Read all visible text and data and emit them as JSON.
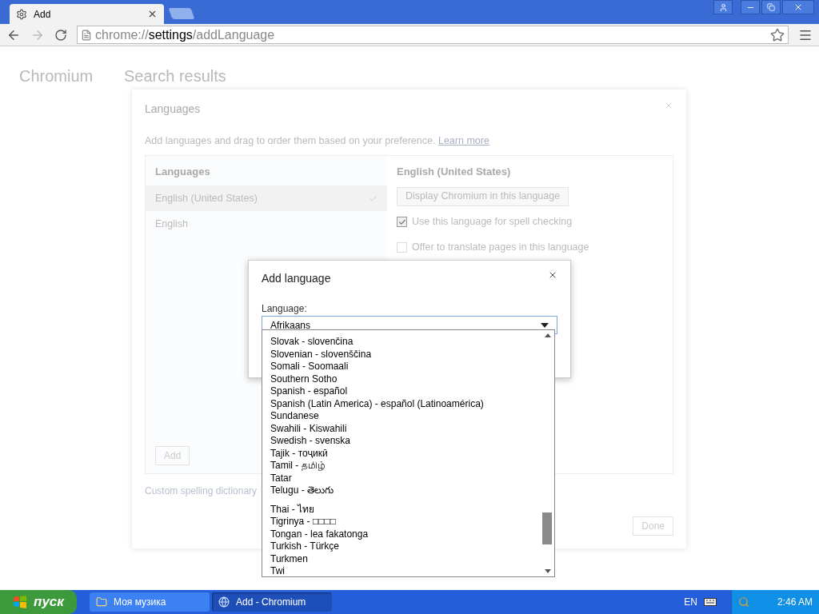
{
  "browser": {
    "tab": {
      "title": "Add"
    },
    "address": {
      "scheme": "chrome://",
      "host": "settings",
      "path": "/addLanguage"
    }
  },
  "settings_page": {
    "title": "Chromium",
    "heading": "Search results"
  },
  "languages_dialog": {
    "title": "Languages",
    "description": "Add languages and drag to order them based on your preference.",
    "link": "Learn more",
    "list_heading": "Languages",
    "languages": [
      {
        "name": "English (United States)",
        "selected": true
      },
      {
        "name": "English",
        "selected": false
      }
    ],
    "detail_heading": "English (United States)",
    "display_button": "Display Chromium in this language",
    "options": [
      {
        "label": "Use this language for spell checking",
        "checked": true
      },
      {
        "label": "Offer to translate pages in this language",
        "checked": false
      }
    ],
    "add_button": "Add",
    "custom_dictionary_link": "Custom spelling dictionary",
    "done_button": "Done"
  },
  "add_language_dialog": {
    "title": "Add language",
    "field_label": "Language:",
    "select_value": "Afrikaans",
    "options": [
      "Slovak - slovenčina",
      "Slovenian - slovenščina",
      "Somali - Soomaali",
      "Southern Sotho",
      "Spanish - español",
      "Spanish (Latin America) - español (Latinoamérica)",
      "Sundanese",
      "Swahili - Kiswahili",
      "Swedish - svenska",
      "Tajik - тоҷикӣ",
      "Tamil - தமிழ்",
      "Tatar",
      "Telugu - తెలుగు",
      "Thai - ไทย",
      "Tigrinya - □□□□",
      "Tongan - lea fakatonga",
      "Turkish - Türkçe",
      "Turkmen",
      "Twi"
    ]
  },
  "taskbar": {
    "start": "пуск",
    "windows": [
      {
        "title": "Моя музика",
        "selected": false
      },
      {
        "title": "Add - Chromium",
        "selected": true
      }
    ],
    "language": "EN",
    "clock": "2:46 AM"
  }
}
